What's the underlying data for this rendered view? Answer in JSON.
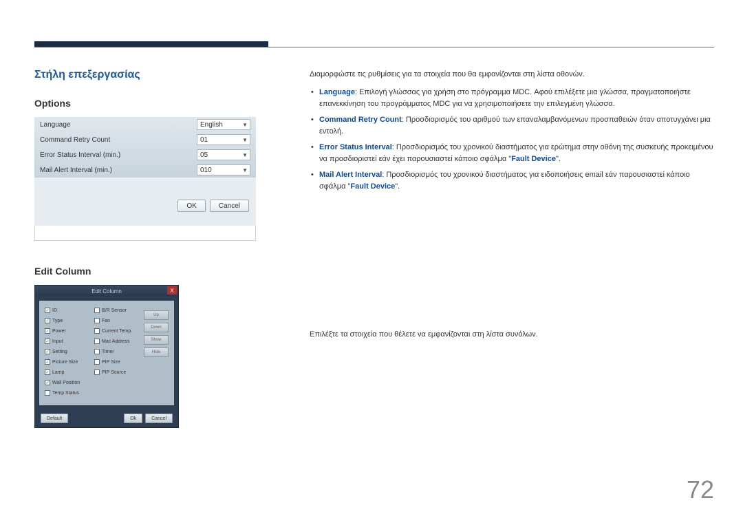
{
  "page_number": "72",
  "section_title": "Στήλη επεξεργασίας",
  "options": {
    "title": "Options",
    "rows": [
      {
        "label": "Language",
        "value": "English"
      },
      {
        "label": "Command Retry Count",
        "value": "01"
      },
      {
        "label": "Error Status Interval (min.)",
        "value": "05"
      },
      {
        "label": "Mail Alert Interval (min.)",
        "value": "010"
      }
    ],
    "ok": "OK",
    "cancel": "Cancel"
  },
  "options_text": {
    "intro": "Διαμορφώστε τις ρυθμίσεις για τα στοιχεία που θα εμφανίζονται στη λίστα οθονών.",
    "items": [
      {
        "term": "Language",
        "body": ": Επιλογή γλώσσας για χρήση στο πρόγραμμα MDC. Αφού επιλέξετε μια γλώσσα, πραγματοποιήστε επανεκκίνηση του προγράμματος MDC για να χρησιμοποιήσετε την επιλεγμένη γλώσσα."
      },
      {
        "term": "Command Retry Count",
        "body": ": Προσδιορισμός του αριθμού των επαναλαμβανόμενων προσπαθειών όταν αποτυγχάνει μια εντολή."
      },
      {
        "term": "Error Status Interval",
        "body_pre": ": Προσδιορισμός του χρονικού διαστήματος για ερώτημα στην οθόνη της συσκευής προκειμένου να προσδιοριστεί εάν έχει παρουσιαστεί κάποιο σφάλμα \"",
        "quoted": "Fault Device",
        "body_post": "\"."
      },
      {
        "term": "Mail Alert Interval",
        "body_pre": ": Προσδιορισμός του χρονικού διαστήματος για ειδοποιήσεις email εάν παρουσιαστεί κάποιο σφάλμα \"",
        "quoted": "Fault Device",
        "body_post": "\"."
      }
    ]
  },
  "edit_column": {
    "title": "Edit Column",
    "dialog_title": "Edit Column",
    "close": "X",
    "col1": [
      {
        "label": "ID",
        "checked": true
      },
      {
        "label": "Type",
        "checked": true
      },
      {
        "label": "Power",
        "checked": true
      },
      {
        "label": "Input",
        "checked": true
      },
      {
        "label": "Setting",
        "checked": true
      },
      {
        "label": "Picture Size",
        "checked": true
      },
      {
        "label": "Lamp",
        "checked": true
      },
      {
        "label": "Wall Position",
        "checked": true
      },
      {
        "label": "Temp Status",
        "checked": false
      }
    ],
    "col2": [
      {
        "label": "B/R Sensor",
        "checked": false
      },
      {
        "label": "Fan",
        "checked": false
      },
      {
        "label": "Current Temp.",
        "checked": false
      },
      {
        "label": "Mac Address",
        "checked": false
      },
      {
        "label": "Timer",
        "checked": false
      },
      {
        "label": "PIP Size",
        "checked": false
      },
      {
        "label": "PIP Source",
        "checked": false
      }
    ],
    "sidebtns": [
      "Up",
      "Down",
      "Show",
      "Hide"
    ],
    "default": "Default",
    "ok": "Ok",
    "cancel": "Cancel"
  },
  "edit_column_text": "Επιλέξτε τα στοιχεία που θέλετε να εμφανίζονται στη λίστα συνόλων."
}
